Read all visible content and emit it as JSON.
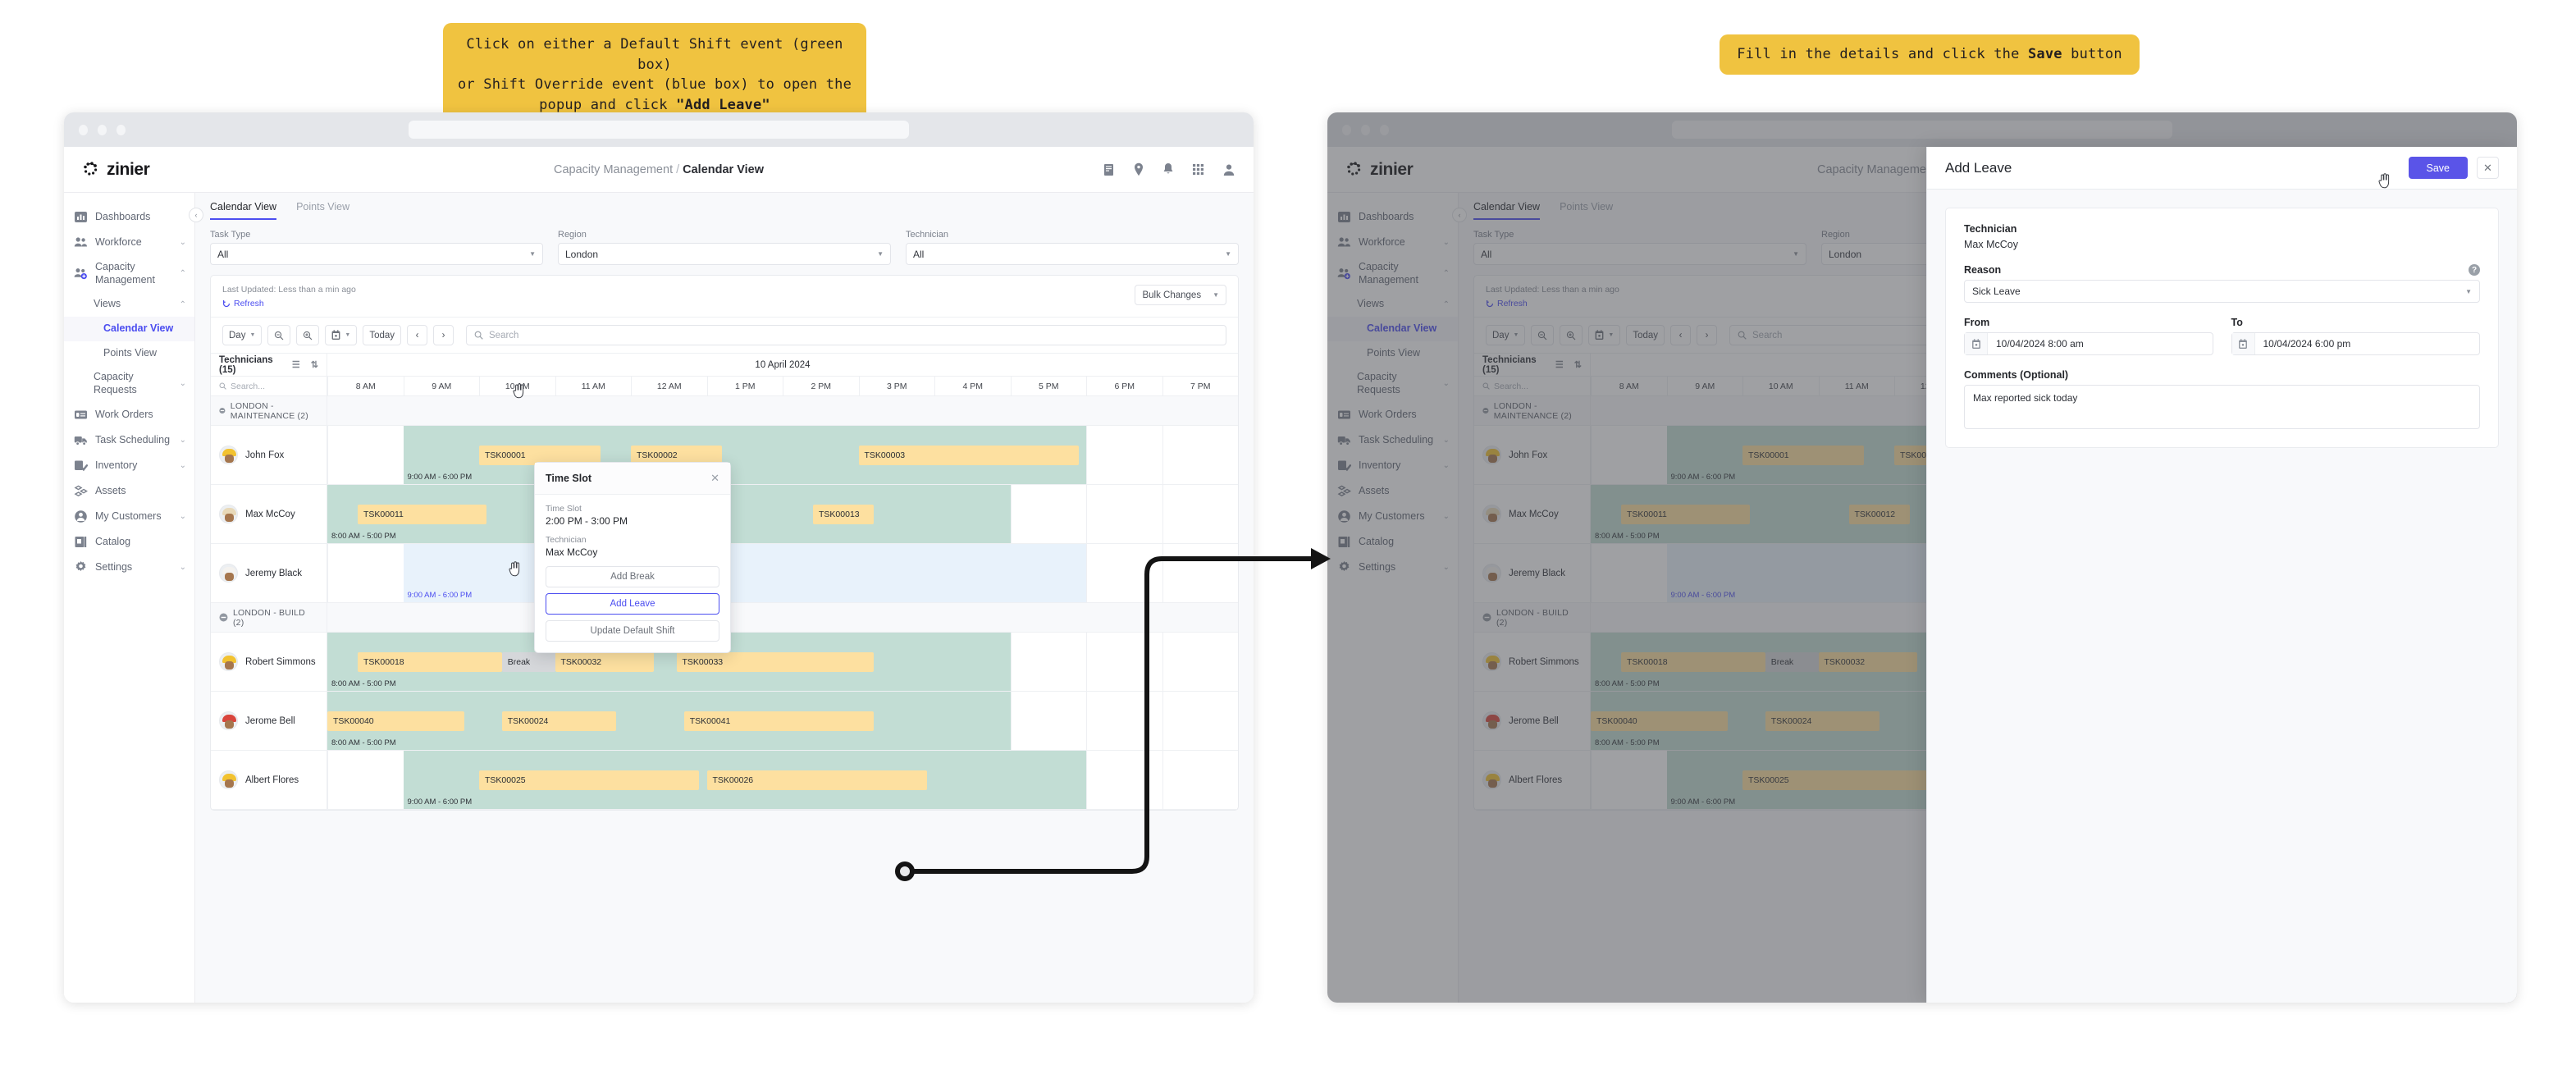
{
  "callouts": [
    {
      "id": "callout-left",
      "lines": [
        "Click on either a Default Shift event (green box)",
        "or Shift Override event (blue box) to open the"
      ],
      "tail_prefix": "popup and click ",
      "tail_bold": "\"Add Leave\""
    },
    {
      "id": "callout-right",
      "prefix": "Fill in the details and click the ",
      "bold": "Save",
      "suffix": " button"
    }
  ],
  "app": {
    "logo_text": "zinier",
    "breadcrumb": {
      "parent": "Capacity Management",
      "separator": "/",
      "current": "Calendar View"
    },
    "header_icons": [
      "notes-icon",
      "location-pin-icon",
      "bell-icon",
      "grid-apps-icon",
      "user-avatar-icon"
    ]
  },
  "sidebar": {
    "collapse_label": "‹",
    "items": [
      {
        "label": "Dashboards",
        "icon": "dashboard-icon",
        "expandable": false
      },
      {
        "label": "Workforce",
        "icon": "people-icon",
        "expandable": true,
        "chevron": "⌄"
      },
      {
        "label": "Capacity Management",
        "icon": "people-add-icon",
        "expandable": true,
        "chevron": "⌃",
        "expanded": true
      },
      {
        "label": "Work Orders",
        "icon": "work-order-icon",
        "expandable": false
      },
      {
        "label": "Task Scheduling",
        "icon": "truck-icon",
        "expandable": true,
        "chevron": "⌄"
      },
      {
        "label": "Inventory",
        "icon": "inventory-icon",
        "expandable": true,
        "chevron": "⌄"
      },
      {
        "label": "Assets",
        "icon": "assets-icon",
        "expandable": false
      },
      {
        "label": "My Customers",
        "icon": "person-circle-icon",
        "expandable": true,
        "chevron": "⌄"
      },
      {
        "label": "Catalog",
        "icon": "catalog-icon",
        "expandable": false
      },
      {
        "label": "Settings",
        "icon": "gear-icon",
        "expandable": true,
        "chevron": "⌄"
      }
    ],
    "sub": {
      "views_label": "Views",
      "views_chevron": "⌃",
      "calendar_view": "Calendar View",
      "points_view": "Points View",
      "capacity_requests": "Capacity Requests",
      "capacity_requests_chevron": "⌄"
    }
  },
  "main": {
    "tabs": [
      {
        "label": "Calendar View",
        "active": true
      },
      {
        "label": "Points View",
        "active": false
      }
    ],
    "filters": [
      {
        "label": "Task Type",
        "value": "All"
      },
      {
        "label": "Region",
        "value": "London"
      },
      {
        "label": "Technician",
        "value": "All"
      }
    ],
    "last_updated": "Last Updated: Less than a min ago",
    "refresh": "Refresh",
    "bulk_changes": "Bulk Changes",
    "toolbar": {
      "view_mode": "Day",
      "zoom_out": "zoom-out-icon",
      "zoom_in": "zoom-in-icon",
      "date_picker": "calendar-icon",
      "today": "Today",
      "prev": "‹",
      "next": "›",
      "search_placeholder": "Search"
    },
    "calendar": {
      "left_header": "Technicians (15)",
      "date_title": "10 April 2024",
      "row_search_placeholder": "Search...",
      "hours": [
        "8 AM",
        "9 AM",
        "10 AM",
        "11 AM",
        "12 AM",
        "1 PM",
        "2 PM",
        "3 PM",
        "4 PM",
        "5 PM",
        "6 PM",
        "7 PM"
      ],
      "groups": [
        {
          "label": "LONDON - MAINTENANCE (2)",
          "technicians": [
            {
              "name": "John Fox",
              "helmet": "#f2c230",
              "shift": {
                "type": "default",
                "start": 1,
                "span": 9,
                "time": "9:00 AM - 6:00 PM"
              },
              "tasks": [
                {
                  "id": "TSK00001",
                  "start": 2,
                  "span": 1.6
                },
                {
                  "id": "TSK00002",
                  "start": 4,
                  "span": 1.2
                },
                {
                  "id": "TSK00003",
                  "start": 7,
                  "span": 2.9
                }
              ]
            },
            {
              "name": "Max McCoy",
              "helmet": "#e8d9b9",
              "shift": {
                "type": "default",
                "start": 0,
                "span": 9,
                "time": "8:00 AM - 5:00 PM"
              },
              "tasks": [
                {
                  "id": "TSK00011",
                  "start": 0.4,
                  "span": 1.7
                },
                {
                  "id": "TSK00012",
                  "start": 3.4,
                  "span": 0.8
                },
                {
                  "id": "TSK00013",
                  "start": 6.4,
                  "span": 0.8
                }
              ]
            },
            {
              "name": "Jeremy Black",
              "helmet": "#f4f2ef",
              "shift": {
                "type": "override",
                "start": 1,
                "span": 9,
                "time": "9:00 AM - 6:00 PM"
              },
              "tasks": []
            }
          ]
        },
        {
          "label": "LONDON - BUILD (2)",
          "technicians": [
            {
              "name": "Robert Simmons",
              "helmet": "#f2c230",
              "shift": {
                "type": "default",
                "start": 0,
                "span": 9,
                "time": "8:00 AM - 5:00 PM"
              },
              "tasks": [
                {
                  "id": "TSK00018",
                  "start": 0.4,
                  "span": 1.9
                },
                {
                  "id": "Break",
                  "start": 2.3,
                  "span": 0.7,
                  "is_break": true
                },
                {
                  "id": "TSK00032",
                  "start": 3.0,
                  "span": 1.3
                },
                {
                  "id": "TSK00033",
                  "start": 4.6,
                  "span": 2.6
                }
              ]
            },
            {
              "name": "Jerome Bell",
              "helmet": "#d9453c",
              "shift": {
                "type": "default",
                "start": 0,
                "span": 9,
                "time": "8:00 AM - 5:00 PM"
              },
              "tasks": [
                {
                  "id": "TSK00040",
                  "start": 0.0,
                  "span": 1.8
                },
                {
                  "id": "TSK00024",
                  "start": 2.3,
                  "span": 1.5
                },
                {
                  "id": "TSK00041",
                  "start": 4.7,
                  "span": 2.5
                }
              ]
            },
            {
              "name": "Albert Flores",
              "helmet": "#f2c230",
              "shift": {
                "type": "default",
                "start": 1,
                "span": 9,
                "time": "9:00 AM - 6:00 PM"
              },
              "tasks": [
                {
                  "id": "TSK00025",
                  "start": 2.0,
                  "span": 2.9
                },
                {
                  "id": "TSK00026",
                  "start": 5.0,
                  "span": 2.9
                }
              ]
            }
          ]
        }
      ]
    }
  },
  "popup": {
    "title": "Time Slot",
    "close": "✕",
    "field_timeslot_label": "Time Slot",
    "field_timeslot_value": "2:00 PM - 3:00 PM",
    "field_tech_label": "Technician",
    "field_tech_value": "Max McCoy",
    "buttons": [
      {
        "label": "Add Break",
        "highlight": false
      },
      {
        "label": "Add Leave",
        "highlight": true
      },
      {
        "label": "Update Default Shift",
        "highlight": false
      }
    ]
  },
  "drawer": {
    "title": "Add Leave",
    "save_label": "Save",
    "close_label": "✕",
    "technician_label": "Technician",
    "technician_value": "Max McCoy",
    "reason_label": "Reason",
    "reason_value": "Sick Leave",
    "reason_help": "?",
    "from_label": "From",
    "from_value": "10/04/2024 8:00 am",
    "to_label": "To",
    "to_value": "10/04/2024 6:00 pm",
    "comments_label": "Comments (Optional)",
    "comments_value": "Max reported sick today"
  },
  "colors": {
    "accent": "#4b4df0",
    "save_button": "#5a54e8",
    "callout_bg": "#f0c340",
    "default_shift": "#c2ddd4",
    "override_shift": "#e8f2fb",
    "task": "#fde0a0",
    "break": "#d5d7da"
  }
}
